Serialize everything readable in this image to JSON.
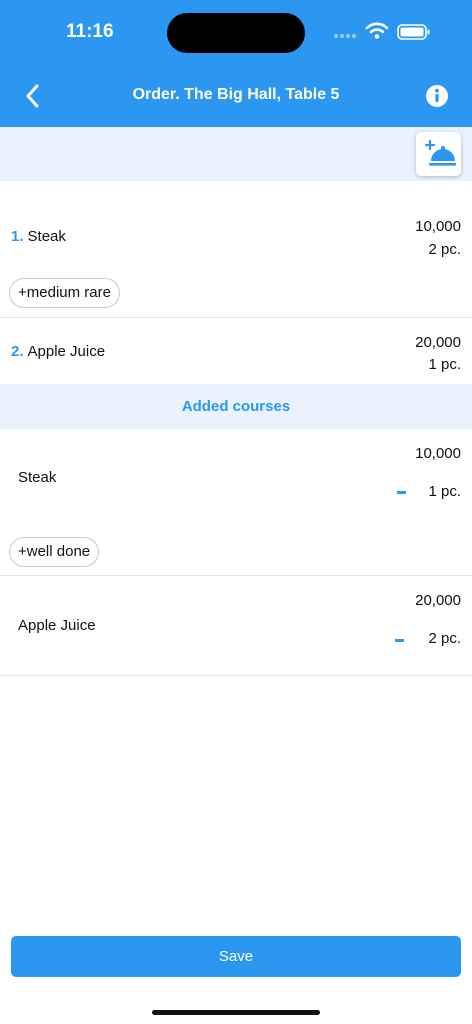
{
  "status": {
    "time": "11:16"
  },
  "nav": {
    "title": "Order. The Big Hall, Table 5"
  },
  "order_items": [
    {
      "number": "1.",
      "name": "Steak",
      "price": "10,000",
      "quantity": "2 pc.",
      "modifier": "+medium rare"
    },
    {
      "number": "2.",
      "name": "Apple Juice",
      "price": "20,000",
      "quantity": "1 pc."
    }
  ],
  "added_section": {
    "title": "Added courses"
  },
  "added_items": [
    {
      "name": "Steak",
      "price": "10,000",
      "quantity": "1 pc.",
      "modifier": "+well done"
    },
    {
      "name": "Apple Juice",
      "price": "20,000",
      "quantity": "2 pc."
    }
  ],
  "footer": {
    "save_label": "Save"
  },
  "colors": {
    "accent": "#2b97f0",
    "section_bg": "#eaf3fd"
  },
  "icons": {
    "back": "chevron-left-icon",
    "info": "info-icon",
    "add_course": "cloche-plus-icon",
    "minus": "minus-icon"
  }
}
